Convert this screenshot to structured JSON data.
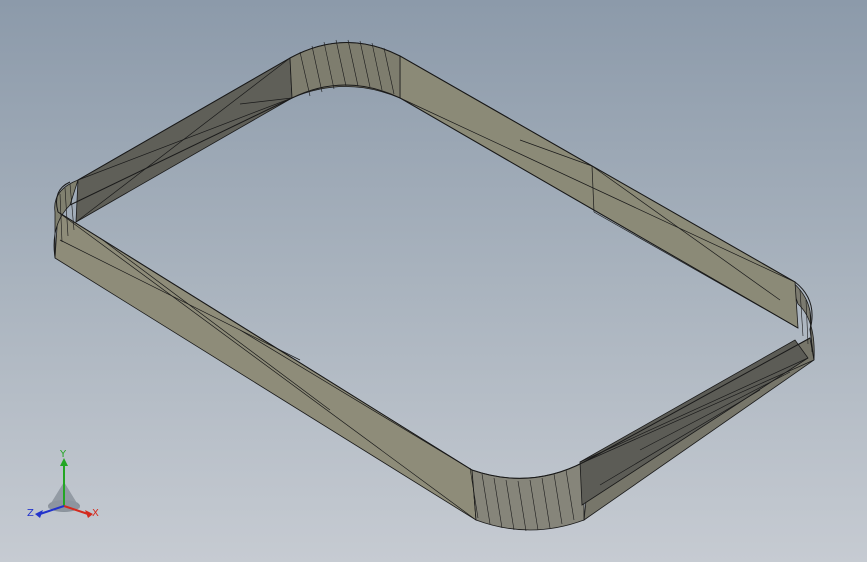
{
  "viewport": {
    "model": "rounded-rectangular-ring-wireframe",
    "colors": {
      "background_top": "#8c9aaa",
      "background_bottom": "#c6cbd2",
      "face_light": "#8d8c78",
      "face_dark": "#5e5e57",
      "edge": "#1a1a1a"
    }
  },
  "triad": {
    "x_label": "X",
    "y_label": "Y",
    "z_label": "Z",
    "colors": {
      "x": "#d42a1e",
      "y": "#23a623",
      "z": "#2233cc"
    }
  }
}
